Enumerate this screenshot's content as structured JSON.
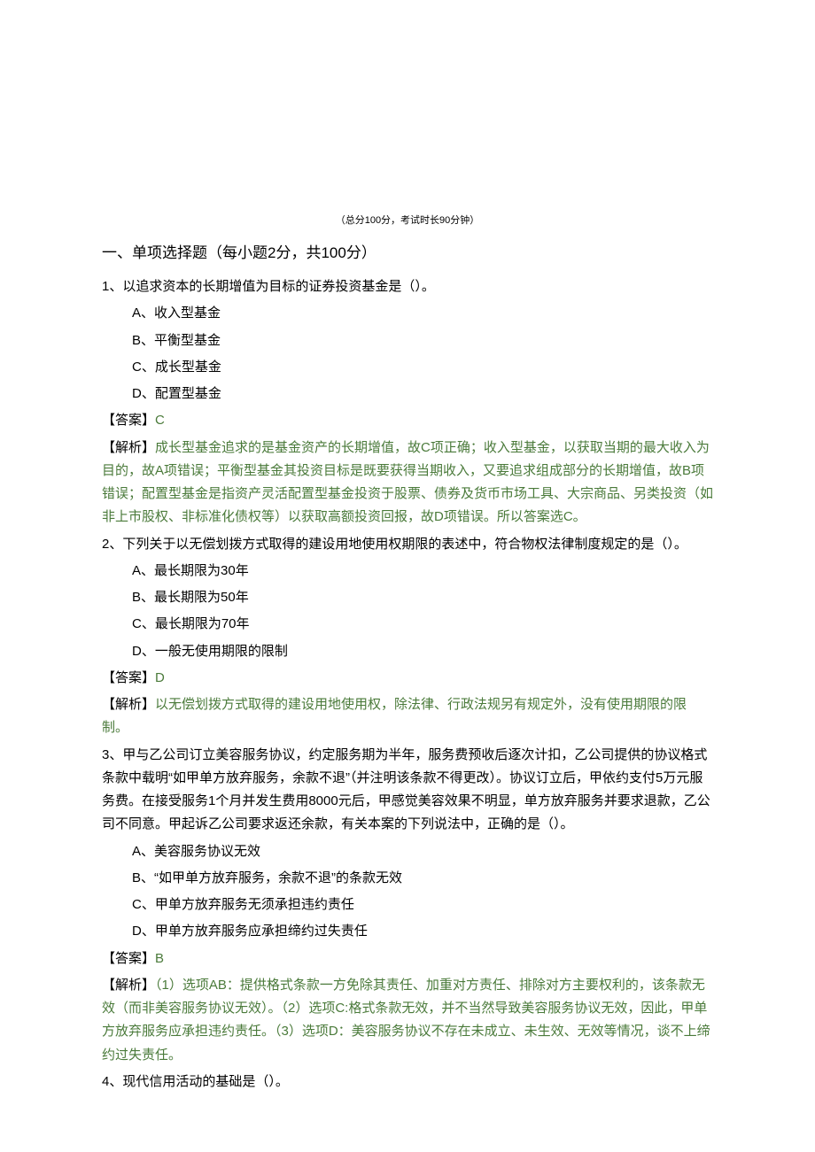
{
  "exam_info": "（总分100分，考试时长90分钟）",
  "section_heading": "一、单项选择题（每小题2分，共100分）",
  "q1": {
    "stem": "1、以追求资本的长期增值为目标的证券投资基金是（）。",
    "optA": "A、收入型基金",
    "optB": "B、平衡型基金",
    "optC": "C、成长型基金",
    "optD": "D、配置型基金",
    "answer_label": "【答案】",
    "answer_val": "C",
    "explain_label": "【解析】",
    "explain_text": "成长型基金追求的是基金资产的长期增值，故C项正确；收入型基金，以获取当期的最大收入为目的，故A项错误；平衡型基金其投资目标是既要获得当期收入，又要追求组成部分的长期增值，故B项错误；配置型基金是指资产灵活配置型基金投资于股票、债券及货币市场工具、大宗商品、另类投资（如非上市股权、非标准化债权等）以获取高额投资回报，故D项错误。所以答案选C。"
  },
  "q2": {
    "stem": "2、下列关于以无偿划拨方式取得的建设用地使用权期限的表述中，符合物权法律制度规定的是（）。",
    "optA": "A、最长期限为30年",
    "optB": "B、最长期限为50年",
    "optC": "C、最长期限为70年",
    "optD": "D、一般无使用期限的限制",
    "answer_label": "【答案】",
    "answer_val": "D",
    "explain_label": "【解析】",
    "explain_text": "以无偿划拨方式取得的建设用地使用权，除法律、行政法规另有规定外，没有使用期限的限制。"
  },
  "q3": {
    "stem": "3、甲与乙公司订立美容服务协议，约定服务期为半年，服务费预收后逐次计扣，乙公司提供的协议格式条款中载明“如甲单方放弃服务，余款不退”（并注明该条款不得更改）。协议订立后，甲依约支付5万元服务费。在接受服务1个月并发生费用8000元后，甲感觉美容效果不明显，单方放弃服务并要求退款，乙公司不同意。甲起诉乙公司要求返还余款，有关本案的下列说法中，正确的是（）。",
    "optA": "A、美容服务协议无效",
    "optB": "B、“如甲单方放弃服务，余款不退”的条款无效",
    "optC": "C、甲单方放弃服务无须承担违约责任",
    "optD": "D、甲单方放弃服务应承担缔约过失责任",
    "answer_label": "【答案】",
    "answer_val": "B",
    "explain_label": "【解析】",
    "explain_text": "（1）选项AB：提供格式条款一方免除其责任、加重对方责任、排除对方主要权利的，该条款无效（而非美容服务协议无效）。（2）选项C:格式条款无效，并不当然导致美容服务协议无效，因此，甲单方放弃服务应承担违约责任。（3）选项D：美容服务协议不存在未成立、未生效、无效等情况，谈不上缔约过失责任。"
  },
  "q4": {
    "stem": "4、现代信用活动的基础是（）。"
  }
}
